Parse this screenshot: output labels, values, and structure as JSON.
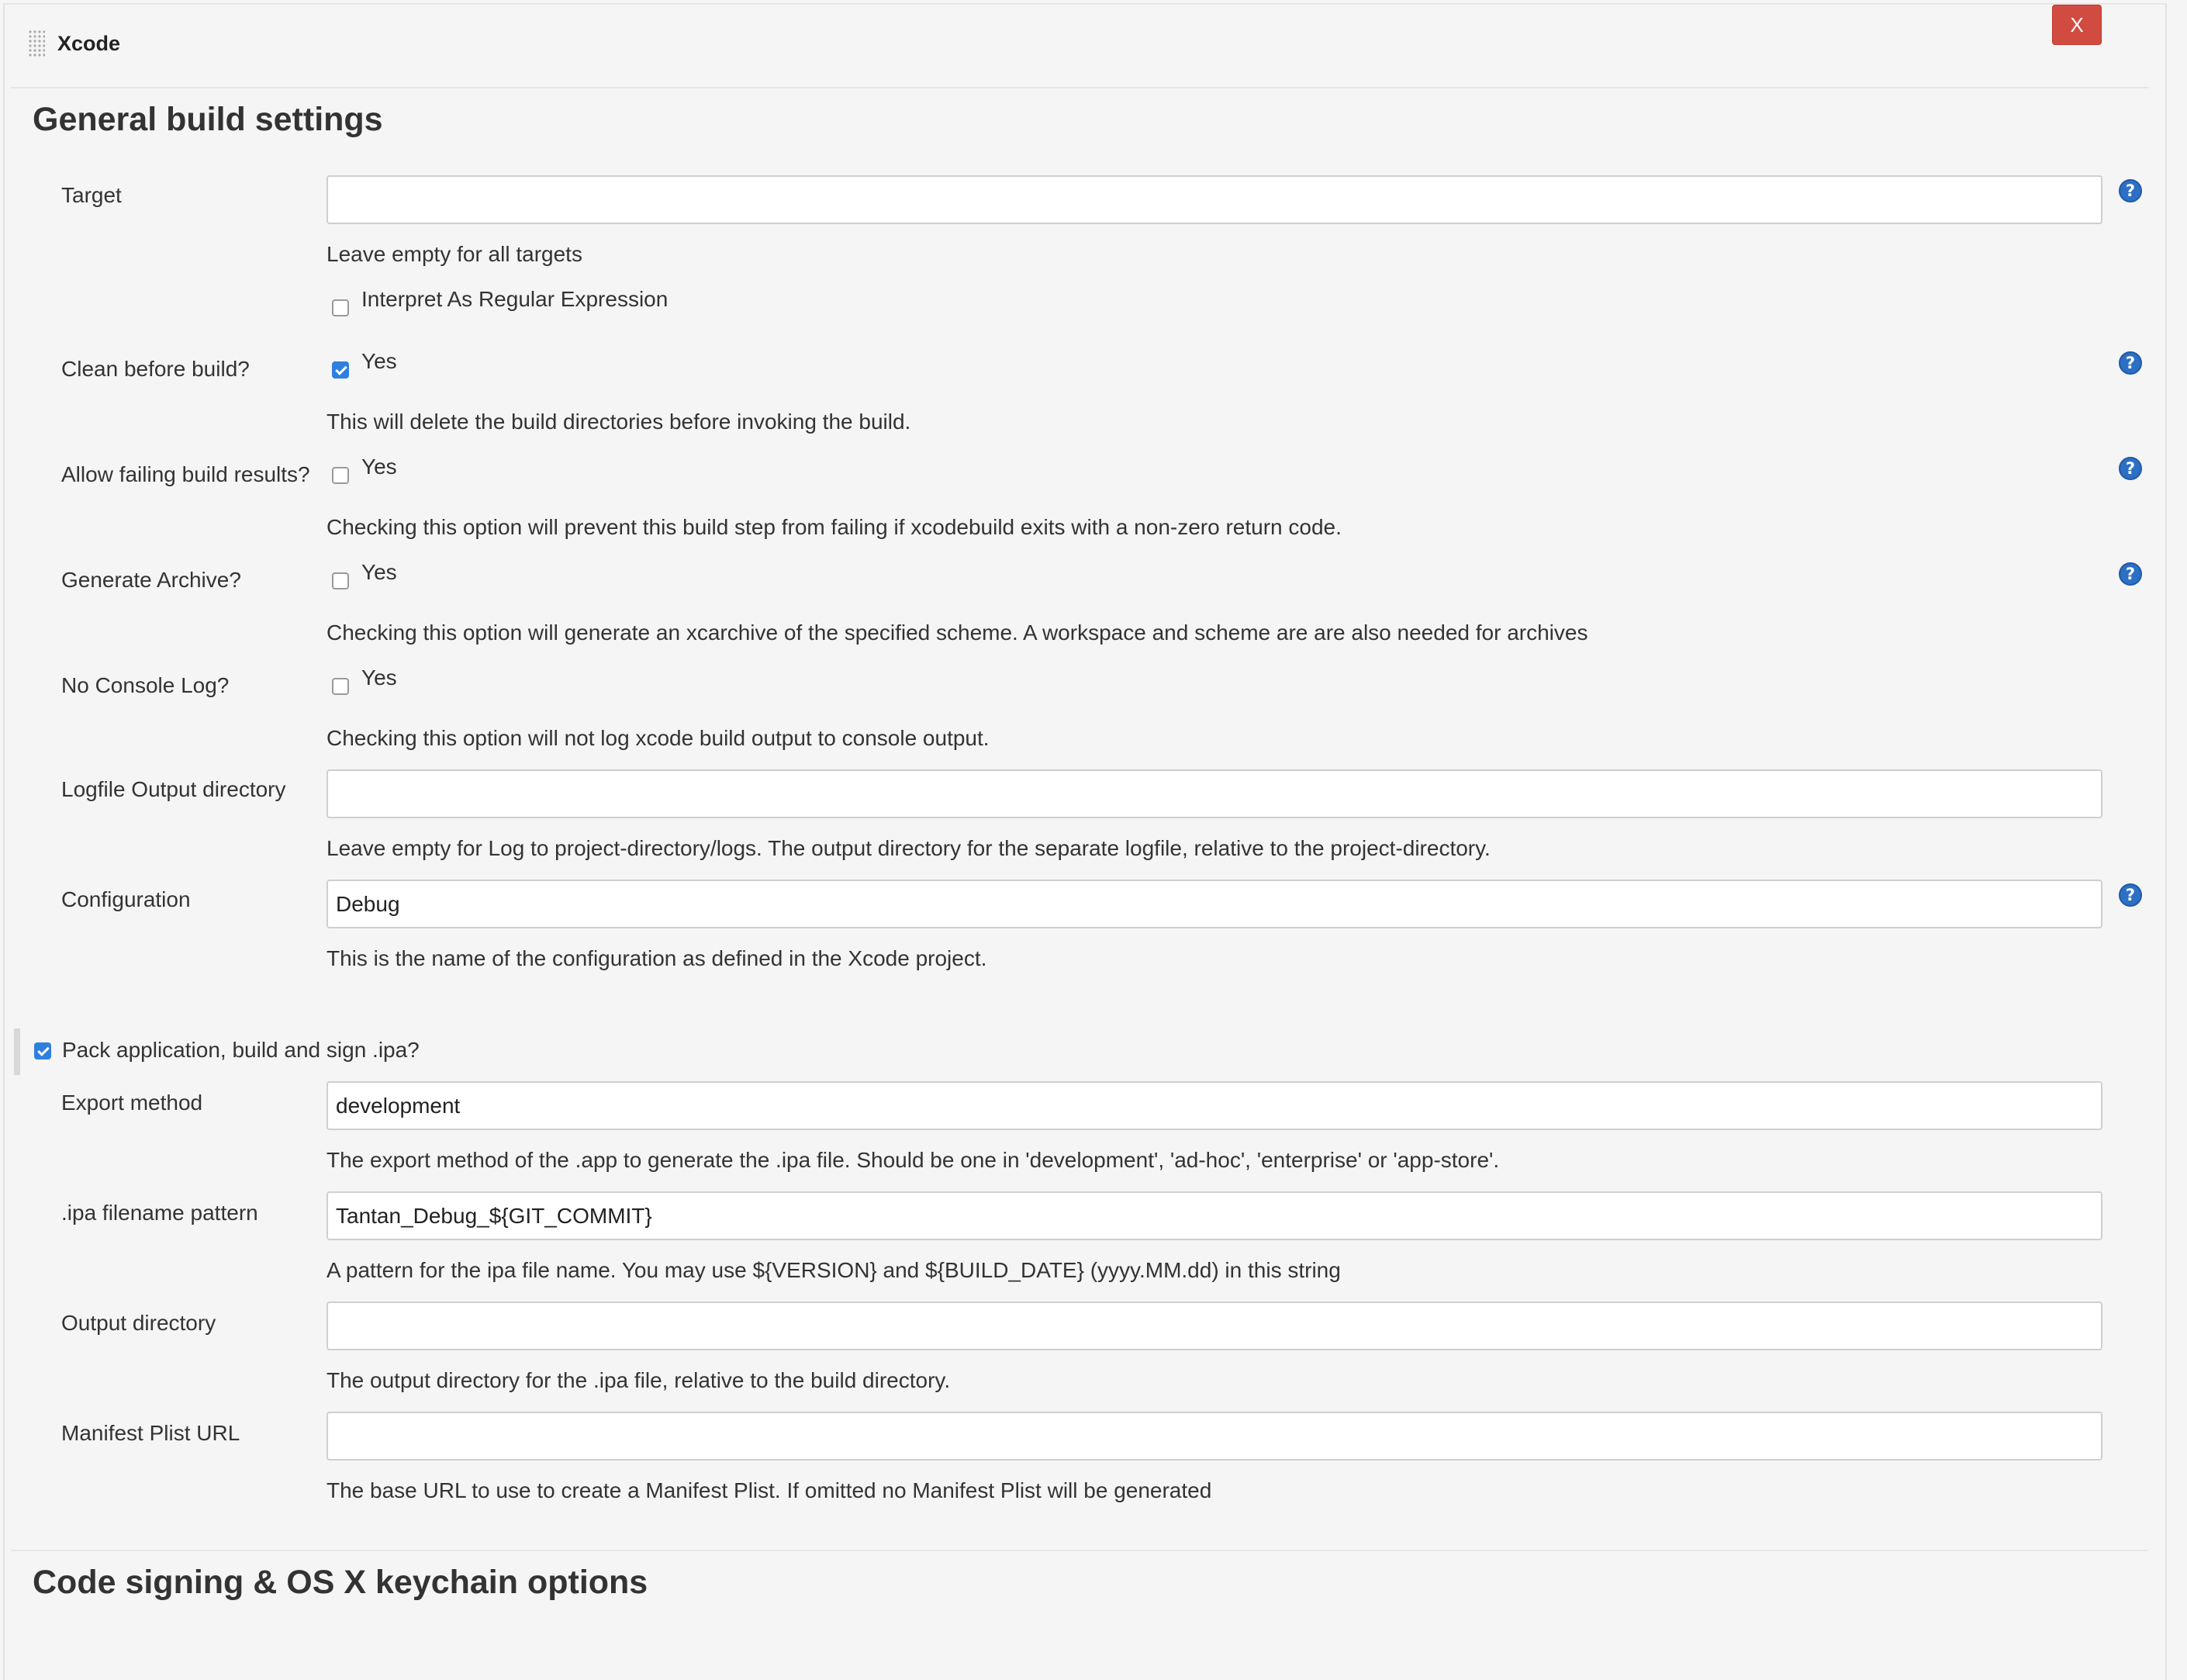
{
  "builder": {
    "title": "Xcode",
    "close_label": "X"
  },
  "general": {
    "heading": "General build settings",
    "target": {
      "label": "Target",
      "value": "",
      "help_text": "Leave empty for all targets",
      "regex_label": "Interpret As Regular Expression",
      "regex_checked": false
    },
    "clean": {
      "label": "Clean before build?",
      "option": "Yes",
      "checked": true,
      "help_text": "This will delete the build directories before invoking the build."
    },
    "allow_failing": {
      "label": "Allow failing build results?",
      "option": "Yes",
      "checked": false,
      "help_text": "Checking this option will prevent this build step from failing if xcodebuild exits with a non-zero return code."
    },
    "generate_archive": {
      "label": "Generate Archive?",
      "option": "Yes",
      "checked": false,
      "help_text": "Checking this option will generate an xcarchive of the specified scheme. A workspace and scheme are are also needed for archives"
    },
    "no_console_log": {
      "label": "No Console Log?",
      "option": "Yes",
      "checked": false,
      "help_text": "Checking this option will not log xcode build output to console output."
    },
    "logfile_dir": {
      "label": "Logfile Output directory",
      "value": "",
      "help_text": "Leave empty for Log to project-directory/logs. The output directory for the separate logfile, relative to the project-directory."
    },
    "configuration": {
      "label": "Configuration",
      "value": "Debug",
      "help_text": "This is the name of the configuration as defined in the Xcode project."
    }
  },
  "pack": {
    "label": "Pack application, build and sign .ipa?",
    "checked": true,
    "export_method": {
      "label": "Export method",
      "value": "development",
      "help_text": "The export method of the .app to generate the .ipa file. Should be one in 'development', 'ad-hoc', 'enterprise' or 'app-store'."
    },
    "ipa_pattern": {
      "label": ".ipa filename pattern",
      "value": "Tantan_Debug_${GIT_COMMIT}",
      "help_text": "A pattern for the ipa file name. You may use ${VERSION} and ${BUILD_DATE} (yyyy.MM.dd) in this string"
    },
    "output_dir": {
      "label": "Output directory",
      "value": "",
      "help_text": "The output directory for the .ipa file, relative to the build directory."
    },
    "manifest_url": {
      "label": "Manifest Plist URL",
      "value": "",
      "help_text": "The base URL to use to create a Manifest Plist. If omitted no Manifest Plist will be generated"
    }
  },
  "signing": {
    "heading": "Code signing & OS X keychain options"
  },
  "icons": {
    "help": "help-icon",
    "drag": "drag-handle-icon",
    "checkmark": "checkmark-icon"
  },
  "colors": {
    "accent": "#2f7fe0",
    "close_button": "#d24b40",
    "help_icon": "#2d6fc4"
  }
}
